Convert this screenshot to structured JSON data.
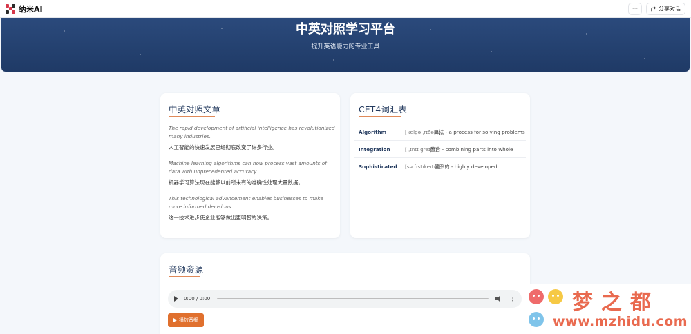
{
  "app": {
    "name": "纳米AI"
  },
  "topbar": {
    "more_label": "···",
    "share_label": "分享对话"
  },
  "hero": {
    "title": "中英对照学习平台",
    "subtitle": "提升英语能力的专业工具"
  },
  "article": {
    "title": "中英对照文章",
    "paragraphs": [
      {
        "en": "The rapid development of artificial intelligence has revolutionized many industries.",
        "cn": "人工智能的快速发展已经彻底改变了许多行业。"
      },
      {
        "en": "Machine learning algorithms can now process vast amounts of data with unprecedented accuracy.",
        "cn": "机器学习算法现在能够以前所未有的准确性处理大量数据。"
      },
      {
        "en": "This technological advancement enables businesses to make more informed decisions.",
        "cn": "这一技术进步使企业能够做出更明智的决策。"
      }
    ]
  },
  "vocab": {
    "title": "CET4词汇表",
    "items": [
      {
        "word": "Algorithm",
        "phonetic": "[ ælgə ˌrɪðəm]",
        "definition": "算法 - a process for solving problems"
      },
      {
        "word": "Integration",
        "phonetic": "[ ˌɪntɪ greɪʃn]",
        "definition": "整合 - combining parts into whole"
      },
      {
        "word": "Sophisticated",
        "phonetic": "[sə fɪstɪkeɪtɪd]",
        "definition": "复杂的 - highly developed"
      }
    ]
  },
  "audio": {
    "title": "音频资源",
    "time": "0:00 / 0:00",
    "play_label": "播放音频"
  },
  "watermark": {
    "text_cn": "梦之都",
    "url": "www.mzhidu.com"
  },
  "colors": {
    "hero": "#2b4a7c",
    "accent": "#e0702e",
    "heading": "#233a5e"
  }
}
